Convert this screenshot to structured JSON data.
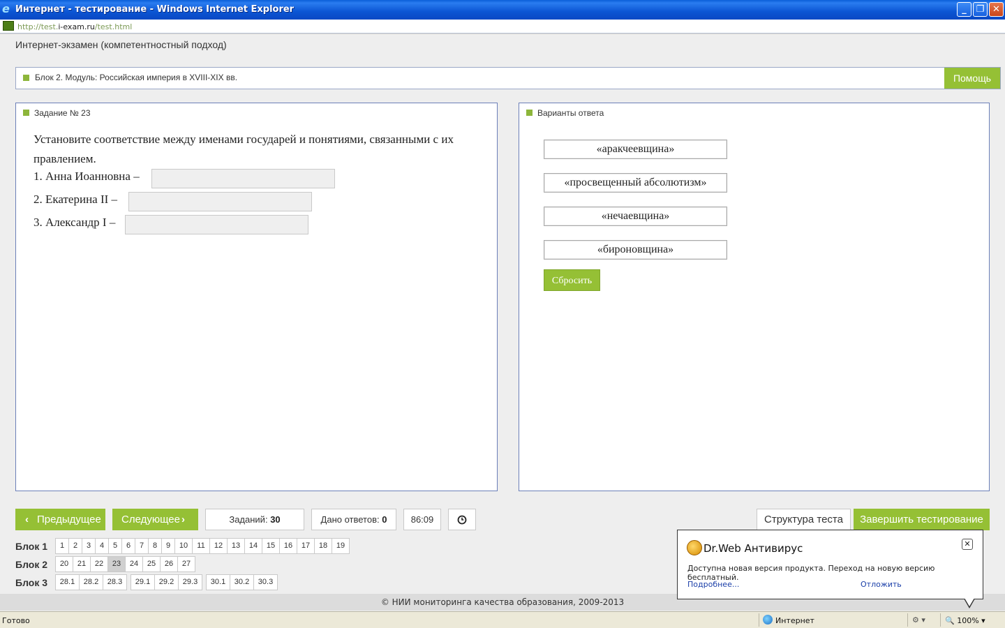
{
  "window": {
    "title": "Интернет - тестирование - Windows Internet Explorer",
    "url_prefix": "http://test.",
    "url_domain": "i-exam.ru",
    "url_suffix": "/test.html",
    "minimize_glyph": "_",
    "maximize_glyph": "❐",
    "close_glyph": "✕"
  },
  "header": {
    "page_title": "Интернет-экзамен (компетентностный подход)",
    "block_label": "Блок 2. Модуль: Российская империя в XVIII-XIX вв.",
    "help_label": "Помощь"
  },
  "task": {
    "heading": "Задание № 23",
    "question": "Установите соответствие между именами государей и понятиями, связанными с их правлением.",
    "items": [
      "1. Анна Иоанновна –",
      "2. Екатерина II –",
      "3. Александр I –"
    ]
  },
  "answers": {
    "heading": "Варианты ответа",
    "options": [
      "«аракчеевщина»",
      "«просвещенный абсолютизм»",
      "«нечаевщина»",
      "«бироновщина»"
    ],
    "reset_label": "Сбросить"
  },
  "navigation": {
    "prev_label": "Предыдущее",
    "next_label": "Следующее",
    "prev_icon": "chevron-left-icon",
    "next_icon": "chevron-right-icon",
    "tasks_label": "Заданий:",
    "tasks_count": "30",
    "answered_label": "Дано ответов:",
    "answered_count": "0",
    "timer": "86:09",
    "clock_icon": "clock-icon",
    "structure_label": "Структура теста",
    "finish_label": "Завершить тестирование"
  },
  "blocks": [
    {
      "label": "Блок 1",
      "cells": [
        "1",
        "2",
        "3",
        "4",
        "5",
        "6",
        "7",
        "8",
        "9",
        "10",
        "11",
        "12",
        "13",
        "14",
        "15",
        "16",
        "17",
        "18",
        "19"
      ]
    },
    {
      "label": "Блок 2",
      "cells": [
        "20",
        "21",
        "22",
        "23",
        "24",
        "25",
        "26",
        "27"
      ],
      "active": "23"
    },
    {
      "label": "Блок 3",
      "groups": [
        [
          "28.1",
          "28.2",
          "28.3"
        ],
        [
          "29.1",
          "29.2",
          "29.3"
        ],
        [
          "30.1",
          "30.2",
          "30.3"
        ]
      ]
    }
  ],
  "footer": "© НИИ мониторинга качества образования, 2009-2013",
  "drweb": {
    "title": "Dr.Web Антивирус",
    "message": "Доступна новая версия продукта. Переход на новую версию бесплатный.",
    "more_link": "Подробнее...",
    "later_link": "Отложить",
    "close_glyph": "✕"
  },
  "status": {
    "text": "Готово",
    "zone": "Интернет",
    "zoom": "100%",
    "protected_glyph": "⚙ ▾",
    "zoom_arrow": "▾"
  },
  "colors": {
    "accent_green": "#95c035",
    "panel_border": "#6b7fb8",
    "titlebar_blue": "#0b55d3"
  }
}
